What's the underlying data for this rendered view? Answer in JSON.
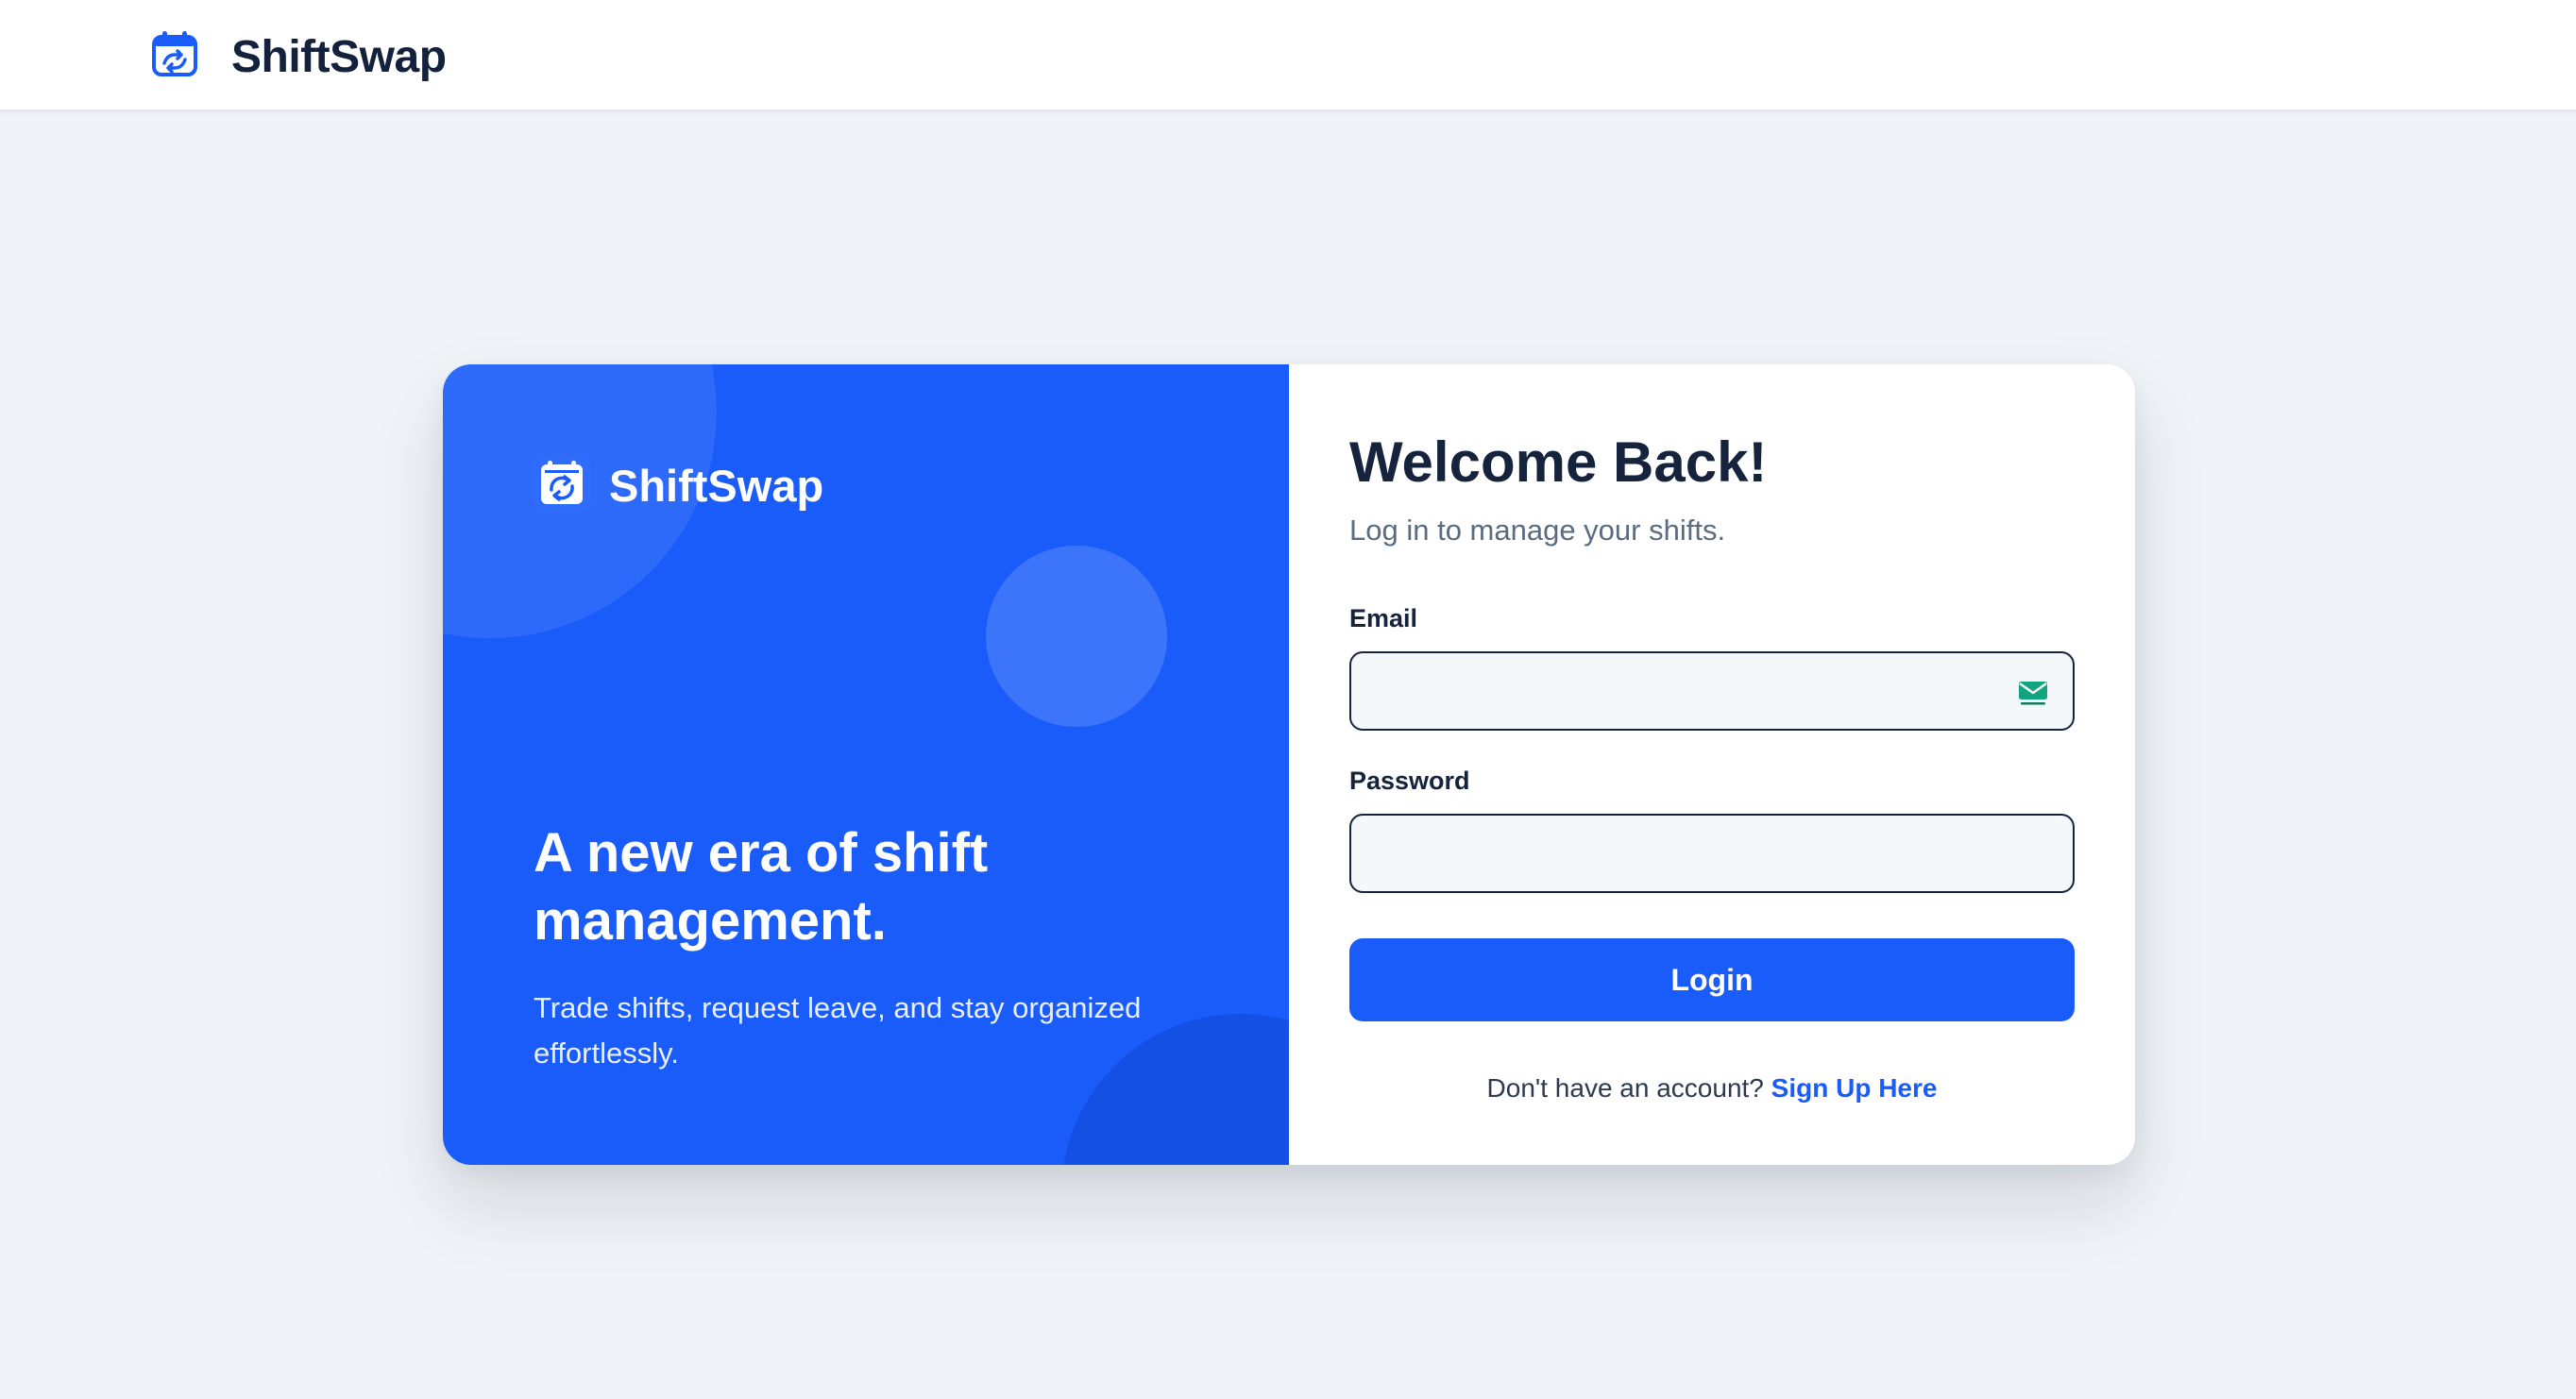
{
  "navbar": {
    "brand": "ShiftSwap",
    "logo_icon": "calendar-swap-icon"
  },
  "hero": {
    "brand": "ShiftSwap",
    "logo_icon": "shift-swap-logo-icon",
    "headline": "A new era of shift management.",
    "subtext": "Trade shifts, request leave, and stay organized effortlessly."
  },
  "form": {
    "title": "Welcome Back!",
    "subtitle": "Log in to manage your shifts.",
    "email_label": "Email",
    "email_value": "",
    "email_icon": "temp-mail-icon",
    "password_label": "Password",
    "password_value": "",
    "login_label": "Login",
    "signup_prompt": "Don't have an account?",
    "signup_link": "Sign Up Here"
  },
  "colors": {
    "primary": "#1a5cfa",
    "page_background": "#f0f3f7",
    "text_dark": "#16233d",
    "text_muted": "#5b6b80",
    "mail_icon": "#12a37f"
  }
}
